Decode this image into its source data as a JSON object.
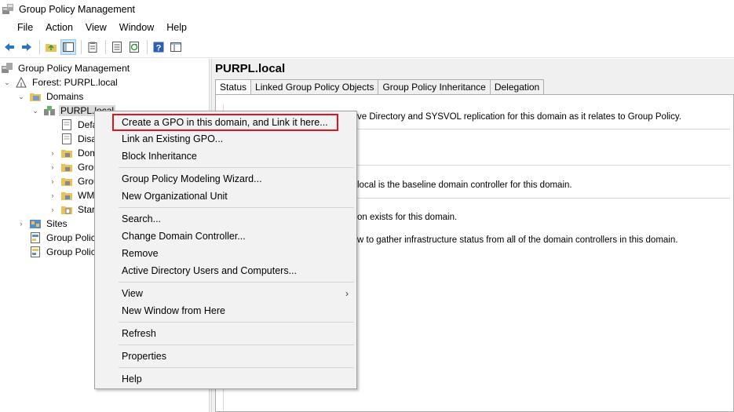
{
  "window": {
    "title": "Group Policy Management"
  },
  "menubar": [
    "File",
    "Action",
    "View",
    "Window",
    "Help"
  ],
  "toolbar": {
    "buttons": [
      "back-icon",
      "forward-icon",
      "up-folder-icon",
      "show-tree-icon",
      "clipboard-icon",
      "properties-icon",
      "refresh-icon",
      "help-icon",
      "details-icon"
    ]
  },
  "tree": {
    "root": "Group Policy Management",
    "forest": "Forest: PURPL.local",
    "domains": "Domains",
    "domain": "PURPL.local",
    "children": [
      "Defa",
      "Disa",
      "Dom",
      "Grou",
      "Grou",
      "WM",
      "Start"
    ],
    "sites": "Sites",
    "modeling": "Group Polic",
    "results": "Group Polic"
  },
  "rightpane": {
    "title": "PURPL.local",
    "tabs": [
      "Status",
      "Linked Group Policy Objects",
      "Group Policy Inheritance",
      "Delegation"
    ],
    "active_tab": "Status",
    "lines": [
      "ve Directory and SYSVOL replication for this domain as it relates to Group Policy.",
      "local is the baseline domain controller for this domain.",
      "on exists for this domain.",
      "w to gather infrastructure status from all of the domain controllers in this domain."
    ]
  },
  "context_menu": {
    "groups": [
      [
        "Create a GPO in this domain, and Link it here...",
        "Link an Existing GPO...",
        "Block Inheritance"
      ],
      [
        "Group Policy Modeling Wizard...",
        "New Organizational Unit"
      ],
      [
        "Search...",
        "Change Domain Controller...",
        "Remove",
        "Active Directory Users and Computers..."
      ],
      [
        "View",
        "New Window from Here"
      ],
      [
        "Refresh"
      ],
      [
        "Properties"
      ],
      [
        "Help"
      ]
    ],
    "submenu_arrow": "›",
    "highlight_color": "#e0141e"
  }
}
